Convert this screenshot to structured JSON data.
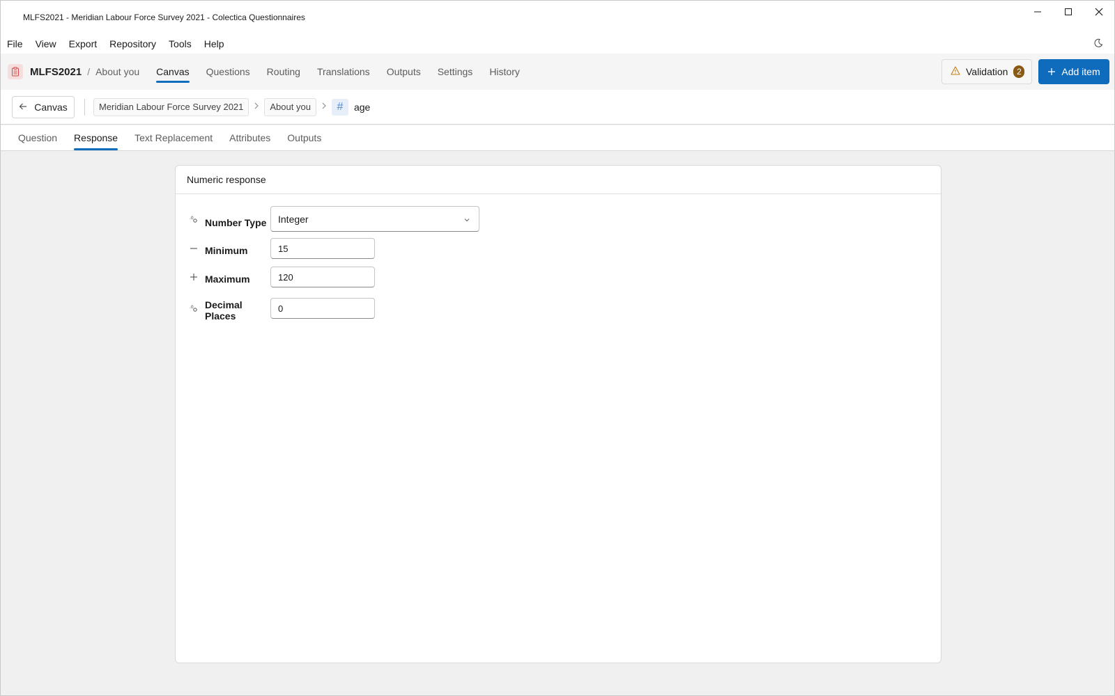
{
  "window": {
    "title": "MLFS2021 - Meridian Labour Force Survey 2021 - Colectica Questionnaires",
    "controls": {
      "minimize": "—",
      "maximize": "☐",
      "close": "✕"
    }
  },
  "menu": {
    "items": [
      "File",
      "View",
      "Export",
      "Repository",
      "Tools",
      "Help"
    ]
  },
  "appbar": {
    "code": "MLFS2021",
    "separator": "/",
    "section": "About you",
    "tabs": [
      "Canvas",
      "Questions",
      "Routing",
      "Translations",
      "Outputs",
      "Settings",
      "History"
    ],
    "active_tab": "Canvas",
    "validation_label": "Validation",
    "validation_count": "2",
    "add_item_label": "Add item"
  },
  "breadcrumb": {
    "back_label": "Canvas",
    "items": [
      "Meridian Labour Force Survey 2021",
      "About you"
    ],
    "current": "age"
  },
  "subtabs": {
    "items": [
      "Question",
      "Response",
      "Text Replacement",
      "Attributes",
      "Outputs"
    ],
    "active": "Response"
  },
  "panel": {
    "title": "Numeric response",
    "number_type_label": "Number Type",
    "number_type_value": "Integer",
    "minimum_label": "Minimum",
    "minimum_value": "15",
    "maximum_label": "Maximum",
    "maximum_value": "120",
    "decimal_label": "Decimal Places",
    "decimal_value": "0"
  },
  "colors": {
    "accent": "#0f6cbd",
    "badge": "#8a5a14"
  }
}
